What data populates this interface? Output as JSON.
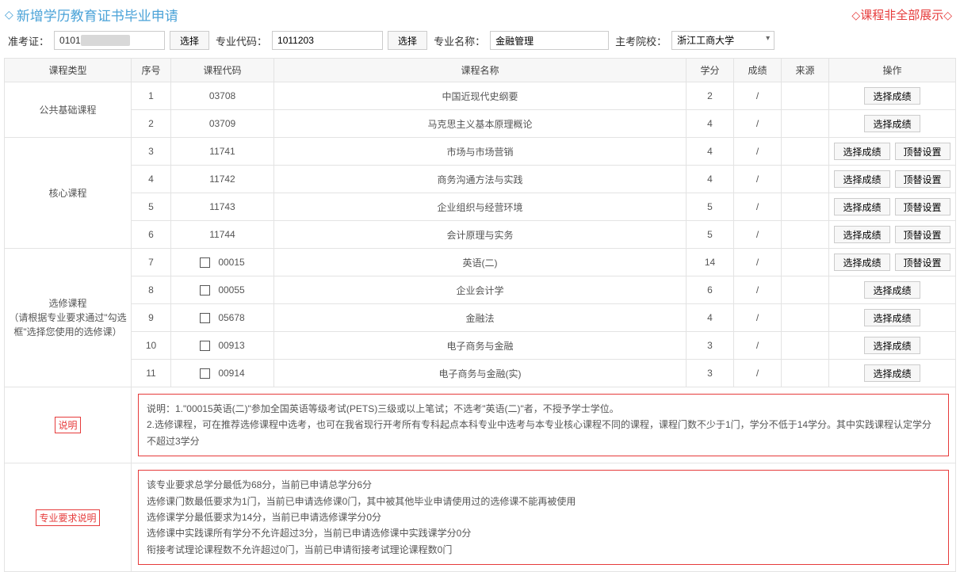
{
  "header": {
    "title": "新增学历教育证书毕业申请",
    "warning": "课程非全部展示"
  },
  "filters": {
    "zkz_label": "准考证：",
    "zkz_value": "0101",
    "zydm_label": "专业代码：",
    "zydm_value": "1011203",
    "zymc_label": "专业名称：",
    "zymc_value": "金融管理",
    "zkyx_label": "主考院校：",
    "zkyx_value": "浙江工商大学",
    "btn_select": "选择"
  },
  "table": {
    "headers": {
      "type": "课程类型",
      "num": "序号",
      "code": "课程代码",
      "name": "课程名称",
      "credit": "学分",
      "score": "成绩",
      "source": "来源",
      "action": "操作"
    },
    "groups": [
      {
        "type": "公共基础课程",
        "rows": [
          {
            "num": "1",
            "code": "03708",
            "name": "中国近现代史纲要",
            "credit": "2",
            "score": "/",
            "checkbox": false,
            "replace": false
          },
          {
            "num": "2",
            "code": "03709",
            "name": "马克思主义基本原理概论",
            "credit": "4",
            "score": "/",
            "checkbox": false,
            "replace": false
          }
        ]
      },
      {
        "type": "核心课程",
        "rows": [
          {
            "num": "3",
            "code": "11741",
            "name": "市场与市场营销",
            "credit": "4",
            "score": "/",
            "checkbox": false,
            "replace": true
          },
          {
            "num": "4",
            "code": "11742",
            "name": "商务沟通方法与实践",
            "credit": "4",
            "score": "/",
            "checkbox": false,
            "replace": true
          },
          {
            "num": "5",
            "code": "11743",
            "name": "企业组织与经营环境",
            "credit": "5",
            "score": "/",
            "checkbox": false,
            "replace": true
          },
          {
            "num": "6",
            "code": "11744",
            "name": "会计原理与实务",
            "credit": "5",
            "score": "/",
            "checkbox": false,
            "replace": true
          }
        ]
      },
      {
        "type": "选修课程\n（请根据专业要求通过\"勾选框\"选择您使用的选修课）",
        "rows": [
          {
            "num": "7",
            "code": "00015",
            "name": "英语(二)",
            "credit": "14",
            "score": "/",
            "checkbox": true,
            "replace": true
          },
          {
            "num": "8",
            "code": "00055",
            "name": "企业会计学",
            "credit": "6",
            "score": "/",
            "checkbox": true,
            "replace": false
          },
          {
            "num": "9",
            "code": "05678",
            "name": "金融法",
            "credit": "4",
            "score": "/",
            "checkbox": true,
            "replace": false
          },
          {
            "num": "10",
            "code": "00913",
            "name": "电子商务与金融",
            "credit": "3",
            "score": "/",
            "checkbox": true,
            "replace": false
          },
          {
            "num": "11",
            "code": "00914",
            "name": "电子商务与金融(实)",
            "credit": "3",
            "score": "/",
            "checkbox": true,
            "replace": false
          }
        ]
      }
    ],
    "btn_select_score": "选择成绩",
    "btn_replace": "顶替设置"
  },
  "desc": {
    "label1": "说明",
    "text1": "说明：1.\"00015英语(二)\"参加全国英语等级考试(PETS)三级或以上笔试；不选考\"英语(二)\"者，不授予学士学位。\n2.选修课程，可在推荐选修课程中选考，也可在我省现行开考所有专科起点本科专业中选考与本专业核心课程不同的课程，课程门数不少于1门，学分不低于14学分。其中实践课程认定学分不超过3学分",
    "label2": "专业要求说明",
    "text2": "该专业要求总学分最低为68分，当前已申请总学分6分\n选修课门数最低要求为1门，当前已申请选修课0门，其中被其他毕业申请使用过的选修课不能再被使用\n选修课学分最低要求为14分，当前已申请选修课学分0分\n选修课中实践课所有学分不允许超过3分，当前已申请选修课中实践课学分0分\n衔接考试理论课程数不允许超过0门，当前已申请衔接考试理论课程数0门"
  }
}
